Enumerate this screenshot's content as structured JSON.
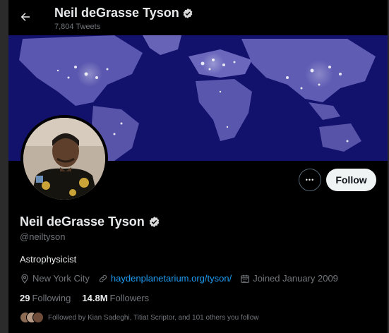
{
  "header": {
    "title": "Neil deGrasse Tyson",
    "tweet_count": "7,804 Tweets",
    "back_icon": "arrow-left-icon",
    "verified_icon": "verified-badge-icon"
  },
  "profile": {
    "name": "Neil deGrasse Tyson",
    "handle": "@neiltyson",
    "bio": "Astrophysicist",
    "location": "New York City",
    "website": "haydenplanetarium.org/tyson/",
    "joined": "Joined January 2009",
    "following_count": "29",
    "following_label": "Following",
    "followers_count": "14.8M",
    "followers_label": "Followers",
    "followed_by": "Followed by Kian Sadeghi, Titiat Scriptor, and 101 others you follow"
  },
  "actions": {
    "more_label": "•••",
    "follow_label": "Follow"
  },
  "colors": {
    "background": "#000000",
    "text_primary": "#e7e9ea",
    "text_secondary": "#71767b",
    "link": "#1d9bf0",
    "follow_button_bg": "#eff3f4",
    "banner": "#0d0d5c"
  }
}
